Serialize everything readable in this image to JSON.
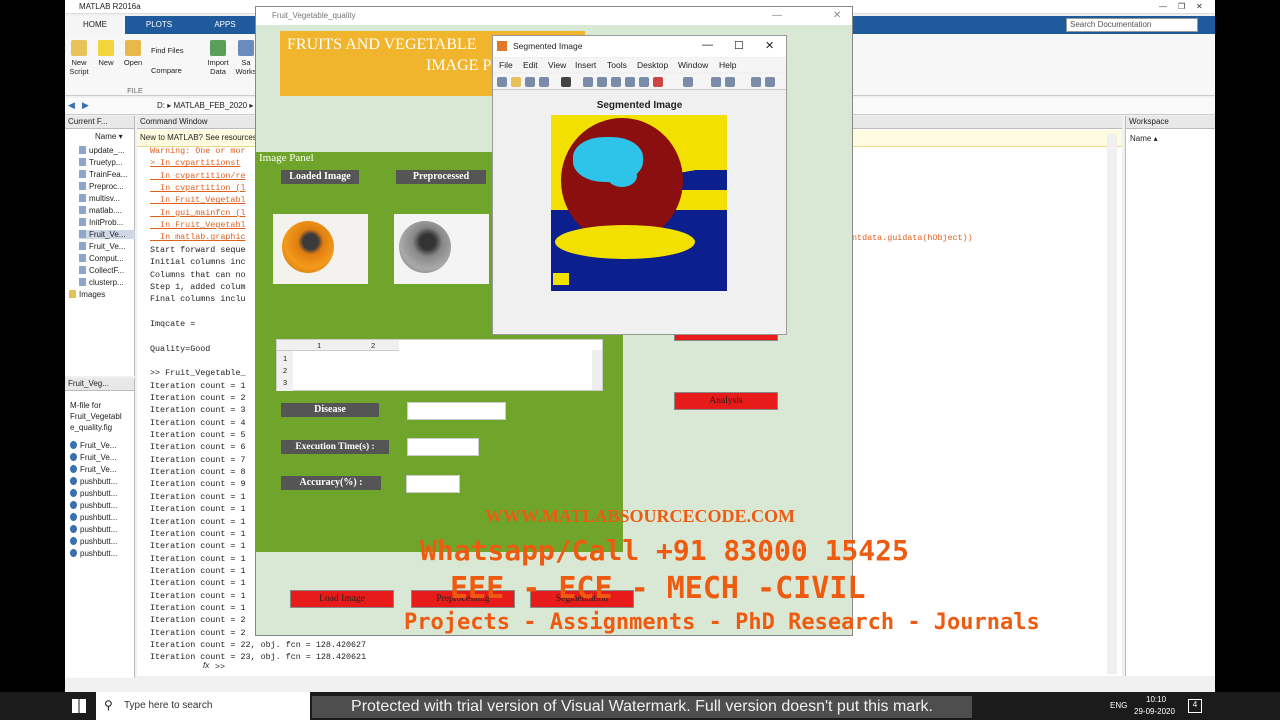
{
  "matlab": {
    "title": "MATLAB R2016a",
    "tabs": [
      "HOME",
      "PLOTS",
      "APPS"
    ],
    "search_placeholder": "Search Documentation",
    "ribbon": {
      "new_script": "New Script",
      "new": "New",
      "open": "Open",
      "find_files": "Find Files",
      "compare": "Compare",
      "import_data": "Import Data",
      "save_workspace": "Sa Works",
      "file_group": "FILE"
    },
    "path": "D: ▸ MATLAB_FEB_2020 ▸",
    "current_folder": {
      "title": "Current F...",
      "name_col": "Name ▾",
      "items": [
        "update_...",
        "Truetyp...",
        "TrainFea...",
        "Preproc...",
        "multisv...",
        "matlab....",
        "InitProb...",
        "Fruit_Ve...",
        "Fruit_Ve...",
        "Comput...",
        "CollectF...",
        "clusterp...",
        "Images"
      ]
    },
    "details": {
      "dropdown": "Fruit_Veg...",
      "description": "M-file for Fruit_Vegetabl e_quality.fig",
      "items": [
        "Fruit_Ve...",
        "Fruit_Ve...",
        "Fruit_Ve...",
        "pushbutt...",
        "pushbutt...",
        "pushbutt...",
        "pushbutt...",
        "pushbutt...",
        "pushbutt...",
        "pushbutt..."
      ]
    },
    "command_window": {
      "title": "Command Window",
      "newbar": "New to MATLAB? See resources",
      "lines": [
        {
          "t": "Warning: One or mor",
          "c": "err"
        },
        {
          "t": "> In cvpartitionst",
          "c": "link"
        },
        {
          "t": "  In cvpartition/re",
          "c": "link"
        },
        {
          "t": "  In cvpartition (l",
          "c": "link"
        },
        {
          "t": "  In Fruit_Vegetabl",
          "c": "link"
        },
        {
          "t": "  In gui_mainfcn (l",
          "c": "link"
        },
        {
          "t": "  In Fruit_Vegetabl",
          "c": "link"
        },
        {
          "t": "  In matlab.graphic",
          "c": "link"
        },
        {
          "t": "Start forward seque",
          "c": ""
        },
        {
          "t": "Initial columns inc",
          "c": ""
        },
        {
          "t": "Columns that can no",
          "c": ""
        },
        {
          "t": "Step 1, added colum",
          "c": ""
        },
        {
          "t": "Final columns inclu",
          "c": ""
        },
        {
          "t": "",
          "c": ""
        },
        {
          "t": "Imqcate =",
          "c": ""
        },
        {
          "t": "",
          "c": ""
        },
        {
          "t": "Quality=Good",
          "c": ""
        },
        {
          "t": "",
          "c": ""
        },
        {
          "t": ">> Fruit_Vegetable_",
          "c": ""
        },
        {
          "t": "Iteration count = 1",
          "c": ""
        },
        {
          "t": "Iteration count = 2",
          "c": ""
        },
        {
          "t": "Iteration count = 3",
          "c": ""
        },
        {
          "t": "Iteration count = 4",
          "c": ""
        },
        {
          "t": "Iteration count = 5",
          "c": ""
        },
        {
          "t": "Iteration count = 6",
          "c": ""
        },
        {
          "t": "Iteration count = 7",
          "c": ""
        },
        {
          "t": "Iteration count = 8",
          "c": ""
        },
        {
          "t": "Iteration count = 9",
          "c": ""
        },
        {
          "t": "Iteration count = 1",
          "c": ""
        },
        {
          "t": "Iteration count = 1",
          "c": ""
        },
        {
          "t": "Iteration count = 1",
          "c": ""
        },
        {
          "t": "Iteration count = 1",
          "c": ""
        },
        {
          "t": "Iteration count = 1",
          "c": ""
        },
        {
          "t": "Iteration count = 1",
          "c": ""
        },
        {
          "t": "Iteration count = 1",
          "c": ""
        },
        {
          "t": "Iteration count = 1",
          "c": ""
        },
        {
          "t": "Iteration count = 1",
          "c": ""
        },
        {
          "t": "Iteration count = 1",
          "c": ""
        },
        {
          "t": "Iteration count = 2",
          "c": ""
        },
        {
          "t": "Iteration count = 2",
          "c": ""
        },
        {
          "t": "Iteration count = 22, obj. fcn = 128.420627",
          "c": ""
        },
        {
          "t": "Iteration count = 23, obj. fcn = 128.420621",
          "c": ""
        }
      ],
      "fx_prompt": ">>",
      "right_fragment": "entdata.guidata(hObject))"
    },
    "workspace": {
      "title": "Workspace",
      "name_col": "Name ▴"
    }
  },
  "gui": {
    "title": "Fruit_Vegetable_quality",
    "heading1": "FRUITS AND VEGETABLE",
    "heading2": "IMAGE P",
    "image_panel": "Image Panel",
    "loaded_image": "Loaded Image",
    "preprocessed": "Preprocessed",
    "table_cols": [
      "1",
      "2"
    ],
    "table_rows": [
      "1",
      "2",
      "3"
    ],
    "disease": "Disease",
    "execution_time": "Execution Time(s) :",
    "accuracy": "Accuracy(%) :",
    "analysis": "Analysis",
    "load_image": "Load Image",
    "preprocessing": "Preprocessing",
    "segmentation": "Segmentation"
  },
  "segmented": {
    "title": "Segmented Image",
    "menu": [
      "File",
      "Edit",
      "View",
      "Insert",
      "Tools",
      "Desktop",
      "Window",
      "Help"
    ],
    "axes_title": "Segmented Image"
  },
  "watermark": {
    "url": "WWW.MATLABSOURCECODE.COM",
    "phone": "Whatsapp/Call +91 83000 15425",
    "branches": "EEE - ECE - MECH -CIVIL",
    "services": "Projects - Assignments - PhD Research - Journals",
    "trial": "Protected with trial version of Visual Watermark. Full version doesn't put this mark."
  },
  "taskbar": {
    "search": "Type here to search",
    "lang": "ENG",
    "time": "10:10",
    "date": "29-09-2020",
    "notif": "4"
  },
  "colors": {
    "gui_green": "#6fa52b",
    "heading_orange": "#f0b52c",
    "button_red": "#e81b1b",
    "watermark": "#ee5b10",
    "matlab_blue": "#1f5a9c"
  }
}
